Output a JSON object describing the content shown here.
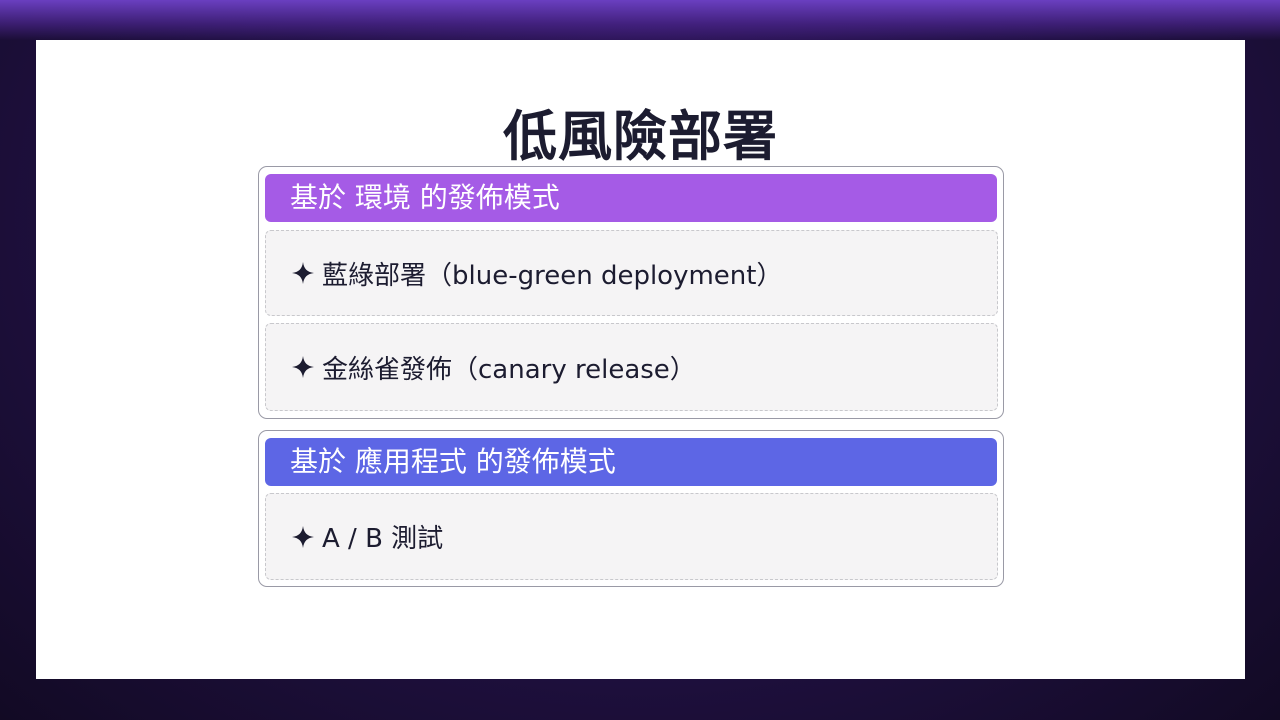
{
  "slide": {
    "title": "低風險部署",
    "sections": [
      {
        "header": "基於 環境 的發佈模式",
        "color": "#a55be6",
        "items": [
          {
            "icon": "four-point-star-icon",
            "label": "藍綠部署（blue-green deployment）"
          },
          {
            "icon": "four-point-star-icon",
            "label": "金絲雀發佈（canary release）"
          }
        ]
      },
      {
        "header": "基於 應用程式 的發佈模式",
        "color": "#5d66e5",
        "items": [
          {
            "icon": "four-point-star-icon",
            "label": "A / B 測試"
          }
        ]
      }
    ]
  },
  "colors": {
    "title_text": "#1c1c30",
    "item_background": "#f5f4f5",
    "slide_background": "#ffffff"
  }
}
